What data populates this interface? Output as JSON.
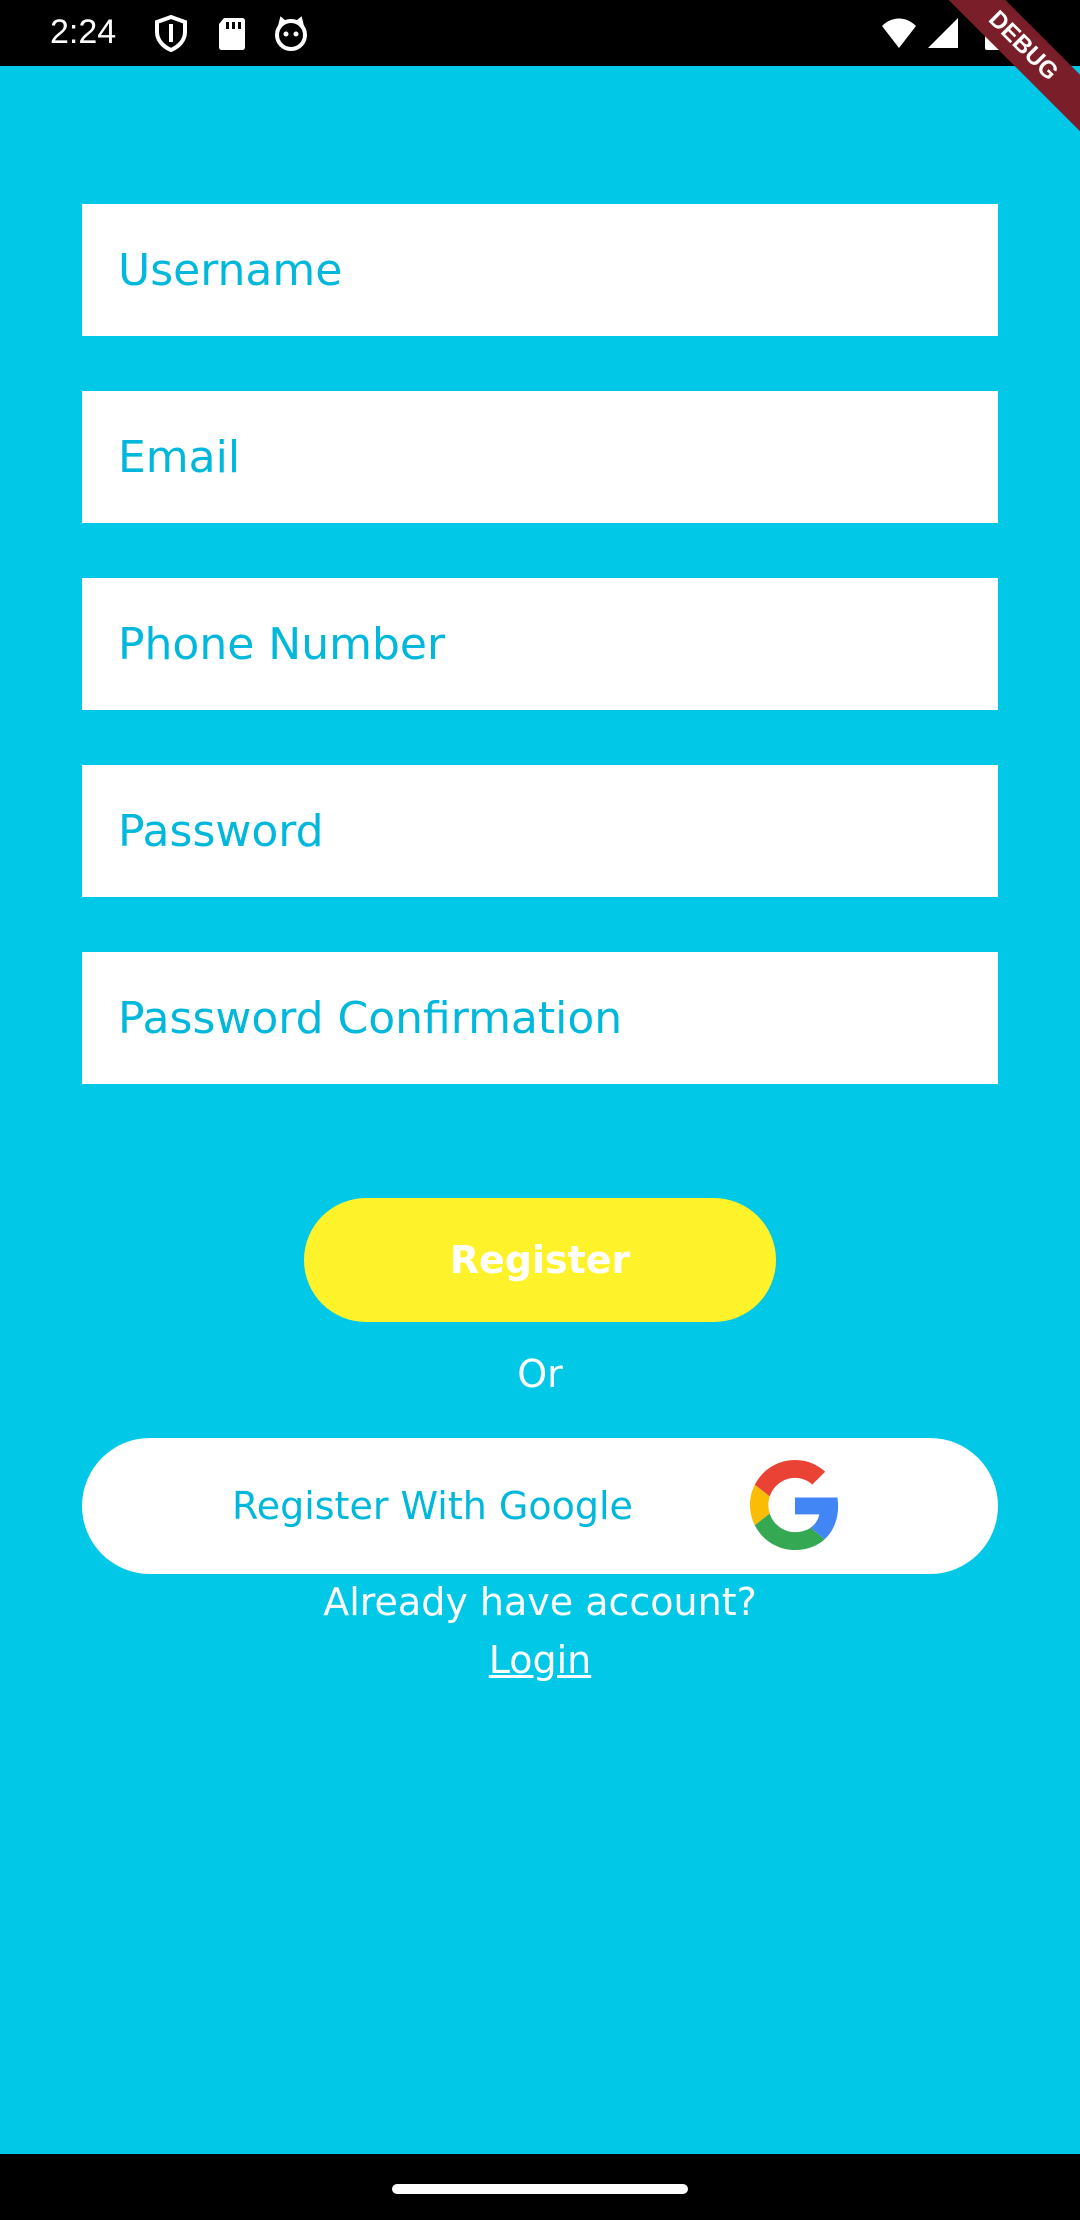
{
  "status_bar": {
    "time": "2:24",
    "icons": [
      "shield-icon",
      "sd-card-icon",
      "cat-face-icon",
      "wifi-icon",
      "signal-icon",
      "battery-icon"
    ]
  },
  "debug_banner": {
    "label": "DEBUG"
  },
  "form": {
    "username_placeholder": "Username",
    "email_placeholder": "Email",
    "phone_placeholder": "Phone Number",
    "password_placeholder": "Password",
    "password_confirmation_placeholder": "Password Confirmation"
  },
  "actions": {
    "register_label": "Register",
    "or_label": "Or",
    "google_label": "Register With Google",
    "already_label": "Already have account?",
    "login_label": "Login"
  },
  "colors": {
    "background": "#00C8E6",
    "accent_text": "#00B8DB",
    "register_button": "#FEF22A"
  }
}
